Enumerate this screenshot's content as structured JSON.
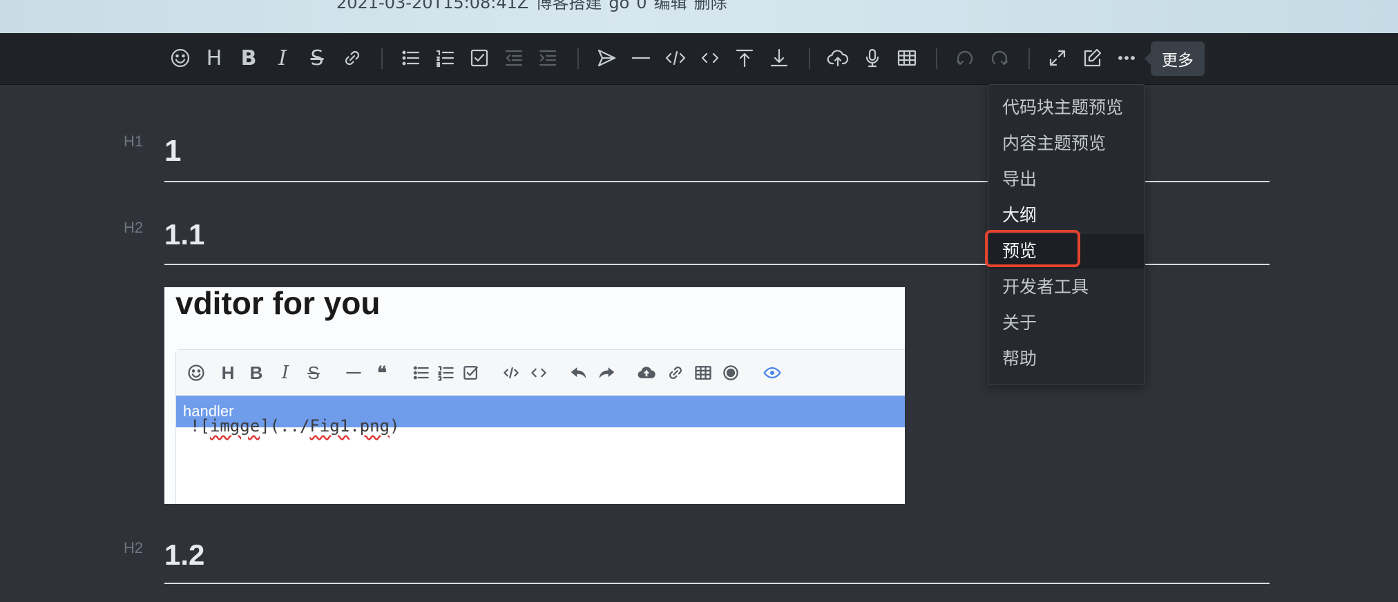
{
  "post_meta": {
    "date": "2021-03-20T15:08:41Z",
    "category": "博客搭建",
    "prefix": "go",
    "count": "0",
    "edit": "编辑",
    "delete": "删除"
  },
  "toolbar": {
    "items": [
      {
        "name": "emoji-icon"
      },
      {
        "name": "headings-icon",
        "label": "H"
      },
      {
        "name": "bold-icon",
        "label": "B"
      },
      {
        "name": "italic-icon",
        "label": "I"
      },
      {
        "name": "strike-icon",
        "label": "S"
      },
      {
        "name": "link-icon"
      },
      {
        "name": "list-icon"
      },
      {
        "name": "ordered-list-icon"
      },
      {
        "name": "check-icon"
      },
      {
        "name": "outdent-icon",
        "disabled": true
      },
      {
        "name": "indent-icon",
        "disabled": true
      },
      {
        "name": "quote-icon"
      },
      {
        "name": "line-icon"
      },
      {
        "name": "code-icon"
      },
      {
        "name": "inline-code-icon"
      },
      {
        "name": "insert-before-icon"
      },
      {
        "name": "insert-after-icon"
      },
      {
        "name": "upload-icon"
      },
      {
        "name": "record-icon"
      },
      {
        "name": "table-icon"
      },
      {
        "name": "undo-icon",
        "disabled": true
      },
      {
        "name": "redo-icon",
        "disabled": true
      },
      {
        "name": "fullscreen-icon"
      },
      {
        "name": "edit-mode-icon"
      },
      {
        "name": "more-icon"
      }
    ],
    "tooltip": "更多"
  },
  "more_menu": {
    "items": [
      {
        "label": "代码块主题预览"
      },
      {
        "label": "内容主题预览"
      },
      {
        "label": "导出"
      },
      {
        "label": "大纲"
      },
      {
        "label": "预览"
      },
      {
        "label": "开发者工具"
      },
      {
        "label": "关于"
      },
      {
        "label": "帮助"
      }
    ],
    "highlighted": "预览",
    "highlight_color": "#e4432d"
  },
  "editor": {
    "headings": [
      {
        "level": "H1",
        "text": "1"
      },
      {
        "level": "H2",
        "text": "1.1"
      },
      {
        "level": "H2",
        "text": "1.2"
      }
    ],
    "embedded_image": {
      "title": "vditor for you",
      "handler": "handler",
      "code": "![imgge](../Fig1.png)",
      "code_parts": [
        "![",
        "imgge",
        "](../",
        "Fig1",
        ".",
        "png",
        ")"
      ],
      "toolbar_items": [
        {
          "name": "emoji-icon"
        },
        {
          "name": "headings-icon",
          "label": "H"
        },
        {
          "name": "bold-icon",
          "label": "B"
        },
        {
          "name": "italic-icon",
          "label": "I"
        },
        {
          "name": "strike-icon",
          "label": "S"
        },
        {
          "name": "line-icon"
        },
        {
          "name": "quote-icon",
          "label": "❝"
        },
        {
          "name": "list-icon"
        },
        {
          "name": "ordered-list-icon"
        },
        {
          "name": "check-icon"
        },
        {
          "name": "code-icon"
        },
        {
          "name": "inline-code-icon"
        },
        {
          "name": "undo-icon"
        },
        {
          "name": "redo-icon"
        },
        {
          "name": "upload-icon"
        },
        {
          "name": "link-icon"
        },
        {
          "name": "table-icon"
        },
        {
          "name": "record-icon"
        },
        {
          "name": "preview-icon"
        }
      ],
      "accent_color": "#6f9ceb"
    }
  }
}
